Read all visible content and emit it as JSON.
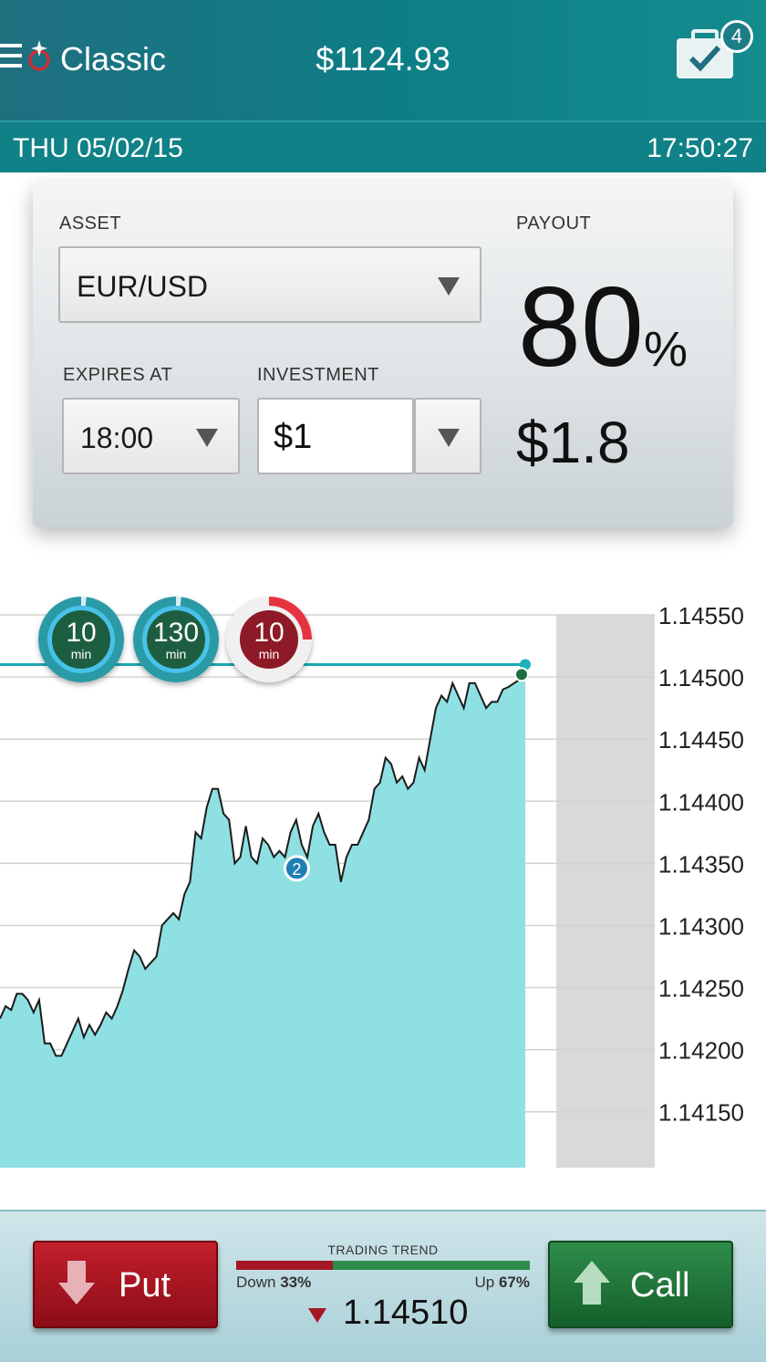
{
  "header": {
    "title": "Classic",
    "balance": "$1124.93",
    "portfolio_count": "4",
    "date": "THU 05/02/15",
    "time": "17:50:27"
  },
  "form": {
    "asset_label": "ASSET",
    "asset_value": "EUR/USD",
    "expires_label": "EXPIRES AT",
    "expires_value": "18:00",
    "investment_label": "INVESTMENT",
    "investment_value": "$1",
    "payout_label": "PAYOUT",
    "payout_percent": "80",
    "payout_percent_sign": "%",
    "payout_amount": "$1.8"
  },
  "expiry_chips": [
    {
      "value": "10",
      "unit": "min",
      "state": "active",
      "color": "#1e5e40"
    },
    {
      "value": "130",
      "unit": "min",
      "state": "active",
      "color": "#1e5e40"
    },
    {
      "value": "10",
      "unit": "min",
      "state": "expiring",
      "color": "#8e1a27"
    }
  ],
  "chart_data": {
    "type": "area",
    "instrument": "EUR/USD",
    "y_ticks": [
      "1.14550",
      "1.14500",
      "1.14450",
      "1.14400",
      "1.14350",
      "1.14300",
      "1.14250",
      "1.14200",
      "1.14150"
    ],
    "ylim": [
      1.14105,
      1.14575
    ],
    "reference_level": 1.1451,
    "position_marker": {
      "label": "2",
      "value": 1.14346
    },
    "values": [
      1.14225,
      1.14235,
      1.14232,
      1.14245,
      1.14245,
      1.1424,
      1.1423,
      1.1424,
      1.14205,
      1.14205,
      1.14195,
      1.14195,
      1.14205,
      1.14215,
      1.14225,
      1.1421,
      1.1422,
      1.14212,
      1.1422,
      1.1423,
      1.14225,
      1.14235,
      1.14248,
      1.14265,
      1.1428,
      1.14275,
      1.14265,
      1.1427,
      1.14275,
      1.143,
      1.14305,
      1.1431,
      1.14305,
      1.14325,
      1.14335,
      1.14375,
      1.1437,
      1.14395,
      1.1441,
      1.1441,
      1.1439,
      1.14385,
      1.1435,
      1.14355,
      1.1438,
      1.14355,
      1.1435,
      1.1437,
      1.14365,
      1.14355,
      1.1436,
      1.14355,
      1.14375,
      1.14385,
      1.14365,
      1.14355,
      1.1438,
      1.1439,
      1.14375,
      1.14365,
      1.14365,
      1.14335,
      1.14355,
      1.14365,
      1.14365,
      1.14375,
      1.14385,
      1.1441,
      1.14415,
      1.14435,
      1.1443,
      1.14415,
      1.1442,
      1.1441,
      1.14415,
      1.14435,
      1.14425,
      1.1445,
      1.14475,
      1.14485,
      1.1448,
      1.14495,
      1.14485,
      1.14475,
      1.14495,
      1.14495,
      1.14485,
      1.14475,
      1.1448,
      1.1448,
      1.1449,
      1.14492,
      1.14495,
      1.14498,
      1.14502
    ],
    "grid": true
  },
  "trade": {
    "put_label": "Put",
    "call_label": "Call",
    "trend_title": "TRADING TREND",
    "down_label": "Down",
    "down_pct": "33%",
    "down_fraction": 0.33,
    "up_label": "Up",
    "up_pct": "67%",
    "current_price": "1.14510"
  }
}
